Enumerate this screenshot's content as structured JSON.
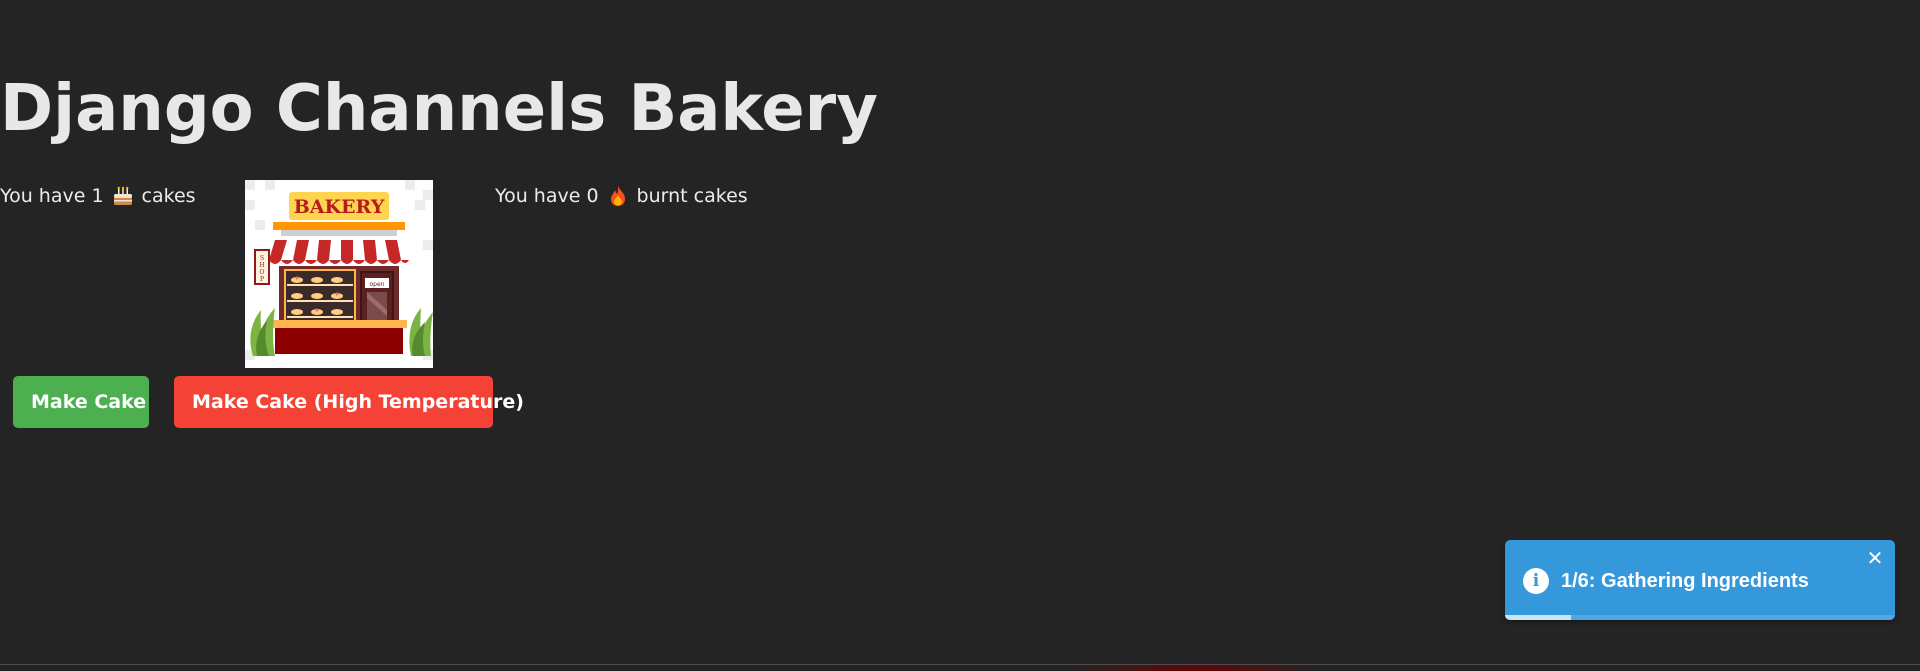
{
  "page": {
    "title": "Django Channels Bakery"
  },
  "stats": {
    "cakes_prefix": "You have 1",
    "cakes_icon": "cake-icon",
    "cakes_suffix": "cakes",
    "burnt_prefix": "You have 0",
    "burnt_icon": "fire-icon",
    "burnt_suffix": "burnt cakes"
  },
  "bakery_image": {
    "sign_text": "BAKERY",
    "shop_text": "SHOP",
    "door_text": "open"
  },
  "buttons": {
    "make_cake": "Make Cake",
    "make_cake_high_temp": "Make Cake (High Temperature)",
    "make_cake_color": "#4caf50",
    "make_cake_high_temp_color": "#f44336"
  },
  "toast": {
    "icon": "info-icon",
    "message": "1/6: Gathering Ingredients",
    "close_icon": "close-icon",
    "close_glyph": "✕",
    "progress_fraction": 0.17,
    "color": "#3498db"
  }
}
